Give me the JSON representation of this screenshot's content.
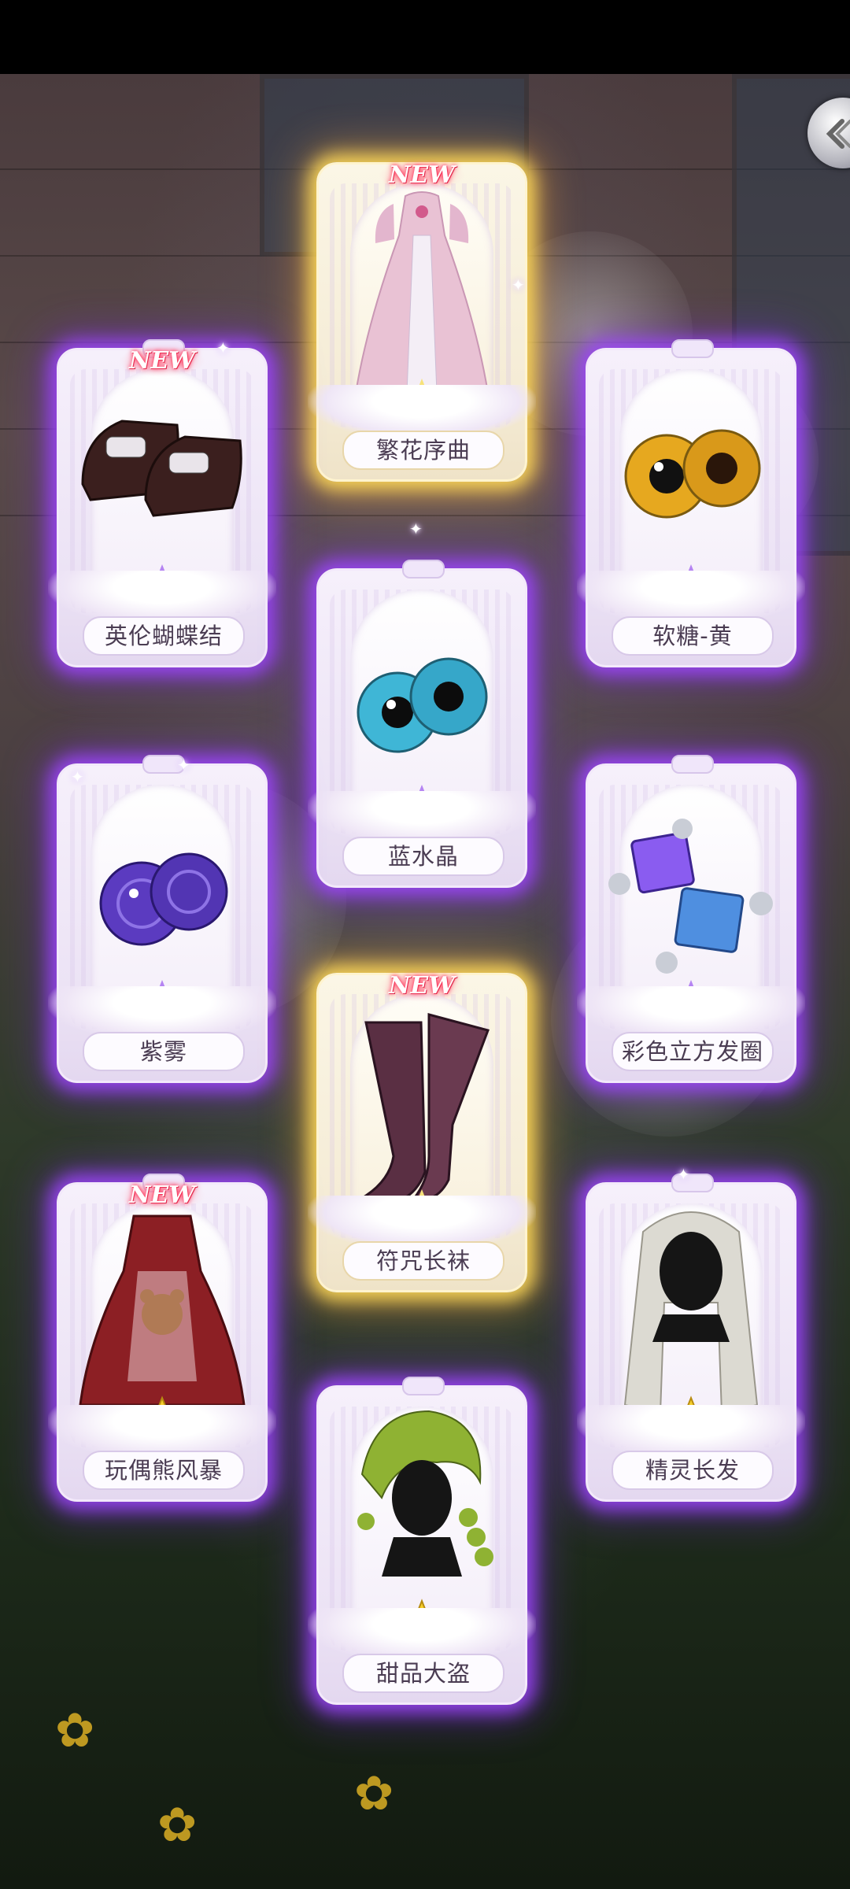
{
  "screen": {
    "title": "",
    "back_button": "back-chevron-icon"
  },
  "new_badge": "NEW",
  "items": [
    {
      "name": "繁花序曲",
      "is_new": true,
      "rarity": "gold",
      "type": "dress"
    },
    {
      "name": "英伦蝴蝶结",
      "is_new": true,
      "rarity": "purple",
      "type": "shoes"
    },
    {
      "name": "软糖-黄",
      "is_new": false,
      "rarity": "purple",
      "type": "eyes"
    },
    {
      "name": "蓝水晶",
      "is_new": false,
      "rarity": "purple",
      "type": "eyes"
    },
    {
      "name": "紫雾",
      "is_new": false,
      "rarity": "purple",
      "type": "eyes"
    },
    {
      "name": "彩色立方发圈",
      "is_new": false,
      "rarity": "purple",
      "type": "hair-accessory"
    },
    {
      "name": "符咒长袜",
      "is_new": true,
      "rarity": "gold",
      "type": "stockings"
    },
    {
      "name": "玩偶熊风暴",
      "is_new": true,
      "rarity": "purple",
      "type": "dress"
    },
    {
      "name": "精灵长发",
      "is_new": false,
      "rarity": "purple",
      "type": "hair"
    },
    {
      "name": "甜品大盗",
      "is_new": false,
      "rarity": "purple",
      "type": "hair"
    }
  ],
  "colors": {
    "purple_glow": "#a046ff",
    "gold_glow": "#ffdc5a",
    "new_text": "#ff2a55"
  }
}
